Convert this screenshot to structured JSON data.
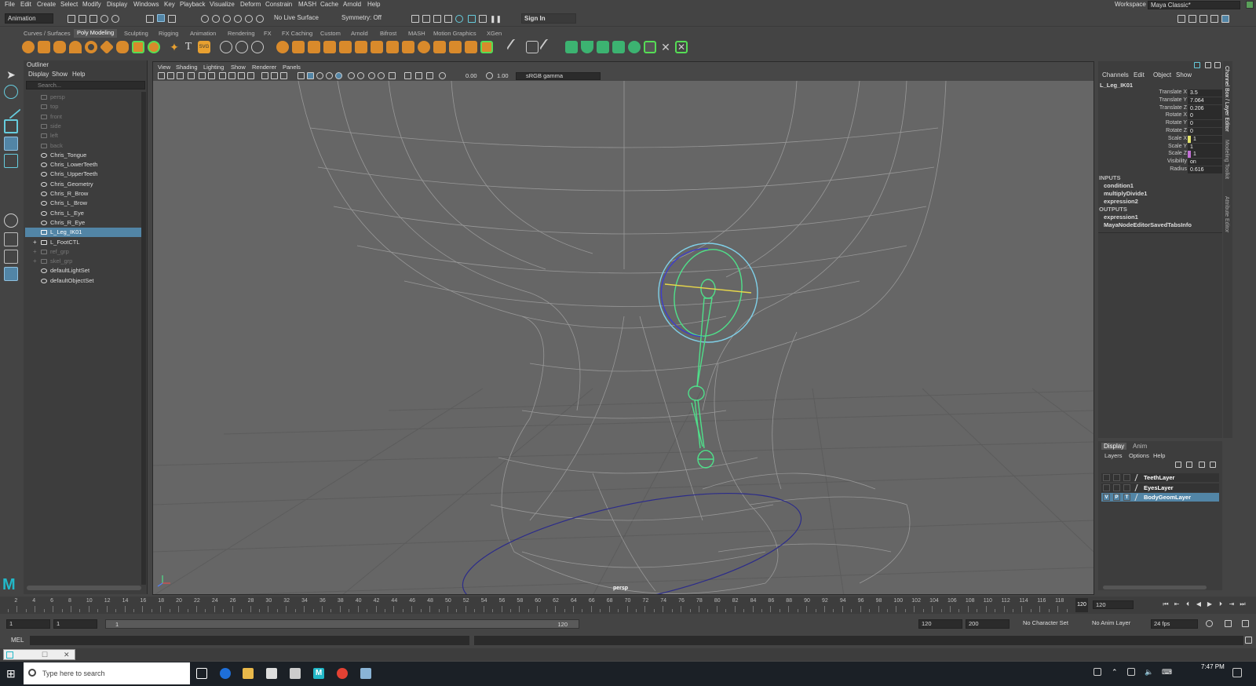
{
  "menubar": {
    "items": [
      "File",
      "Edit",
      "Create",
      "Select",
      "Modify",
      "Display",
      "Windows",
      "Key",
      "Playback",
      "Visualize",
      "Deform",
      "Constrain",
      "MASH",
      "Cache",
      "Arnold",
      "Help"
    ],
    "workspace_label": "Workspace :",
    "workspace_value": "Maya Classic*"
  },
  "statusline": {
    "mode": "Animation",
    "live_surface": "No Live Surface",
    "symmetry": "Symmetry: Off",
    "sign_in": "Sign In"
  },
  "shelf": {
    "tabs": [
      "Curves / Surfaces",
      "Poly Modeling",
      "Sculpting",
      "Rigging",
      "Animation",
      "Rendering",
      "FX",
      "FX Caching",
      "Custom",
      "Arnold",
      "Bifrost",
      "MASH",
      "Motion Graphics",
      "XGen"
    ],
    "active_tab": "Poly Modeling"
  },
  "outliner": {
    "title": "Outliner",
    "menu": [
      "Display",
      "Show",
      "Help"
    ],
    "search_placeholder": "Search...",
    "items": [
      {
        "label": "persp",
        "type": "camera",
        "dim": true,
        "selected": false,
        "expand": false
      },
      {
        "label": "top",
        "type": "camera",
        "dim": true,
        "selected": false,
        "expand": false
      },
      {
        "label": "front",
        "type": "camera",
        "dim": true,
        "selected": false,
        "expand": false
      },
      {
        "label": "side",
        "type": "camera",
        "dim": true,
        "selected": false,
        "expand": false
      },
      {
        "label": "left",
        "type": "camera",
        "dim": true,
        "selected": false,
        "expand": false
      },
      {
        "label": "back",
        "type": "camera",
        "dim": true,
        "selected": false,
        "expand": false
      },
      {
        "label": "Chris_Tongue",
        "type": "mesh",
        "dim": false,
        "selected": false,
        "expand": false
      },
      {
        "label": "Chris_LowerTeeth",
        "type": "mesh",
        "dim": false,
        "selected": false,
        "expand": false
      },
      {
        "label": "Chris_UpperTeeth",
        "type": "mesh",
        "dim": false,
        "selected": false,
        "expand": false
      },
      {
        "label": "Chris_Geometry",
        "type": "mesh",
        "dim": false,
        "selected": false,
        "expand": false
      },
      {
        "label": "Chris_R_Brow",
        "type": "mesh",
        "dim": false,
        "selected": false,
        "expand": false
      },
      {
        "label": "Chris_L_Brow",
        "type": "mesh",
        "dim": false,
        "selected": false,
        "expand": false
      },
      {
        "label": "Chris_L_Eye",
        "type": "mesh",
        "dim": false,
        "selected": false,
        "expand": false
      },
      {
        "label": "Chris_R_Eye",
        "type": "mesh",
        "dim": false,
        "selected": false,
        "expand": false
      },
      {
        "label": "L_Leg_IK01",
        "type": "ik",
        "dim": false,
        "selected": true,
        "expand": false
      },
      {
        "label": "L_FootCTL",
        "type": "curve",
        "dim": false,
        "selected": false,
        "expand": true
      },
      {
        "label": "ref_grp",
        "type": "group",
        "dim": true,
        "selected": false,
        "expand": true
      },
      {
        "label": "skel_grp",
        "type": "group",
        "dim": true,
        "selected": false,
        "expand": true
      },
      {
        "label": "defaultLightSet",
        "type": "set",
        "dim": false,
        "selected": false,
        "expand": false
      },
      {
        "label": "defaultObjectSet",
        "type": "set",
        "dim": false,
        "selected": false,
        "expand": false
      }
    ]
  },
  "viewport": {
    "menu": [
      "View",
      "Shading",
      "Lighting",
      "Show",
      "Renderer",
      "Panels"
    ],
    "exposure": "0.00",
    "gamma_value": "1.00",
    "color_space": "sRGB gamma",
    "camera_label": "persp"
  },
  "channelbox": {
    "menu": [
      "Channels",
      "Edit",
      "Object",
      "Show"
    ],
    "object_name": "L_Leg_IK01",
    "attributes": [
      {
        "name": "Translate X",
        "value": "3.5",
        "key": ""
      },
      {
        "name": "Translate Y",
        "value": "7.064",
        "key": ""
      },
      {
        "name": "Translate Z",
        "value": "0.206",
        "key": ""
      },
      {
        "name": "Rotate X",
        "value": "0",
        "key": ""
      },
      {
        "name": "Rotate Y",
        "value": "0",
        "key": ""
      },
      {
        "name": "Rotate Z",
        "value": "0",
        "key": ""
      },
      {
        "name": "Scale X",
        "value": "1",
        "key": "yellow"
      },
      {
        "name": "Scale Y",
        "value": "1",
        "key": ""
      },
      {
        "name": "Scale Z",
        "value": "1",
        "key": "purple"
      },
      {
        "name": "Visibility",
        "value": "on",
        "key": ""
      },
      {
        "name": "Radius",
        "value": "0.616",
        "key": ""
      }
    ],
    "inputs_header": "INPUTS",
    "inputs": [
      "condition1",
      "multiplyDivide1",
      "expression2"
    ],
    "outputs_header": "OUTPUTS",
    "outputs": [
      "expression1",
      "MayaNodeEditorSavedTabsInfo"
    ]
  },
  "sidetabs": [
    "Channel Box / Layer Editor",
    "Modeling Toolkit",
    "Attribute Editor"
  ],
  "layers": {
    "tabs": [
      "Display",
      "Anim"
    ],
    "menu": [
      "Layers",
      "Options",
      "Help"
    ],
    "rows": [
      {
        "name": "TeethLayer",
        "v": "",
        "p": "",
        "t": "",
        "selected": false
      },
      {
        "name": "EyesLayer",
        "v": "",
        "p": "",
        "t": "",
        "selected": false
      },
      {
        "name": "BodyGeomLayer",
        "v": "V",
        "p": "P",
        "t": "T",
        "selected": true
      }
    ]
  },
  "timeline": {
    "ticks": [
      "2",
      "4",
      "6",
      "8",
      "10",
      "12",
      "14",
      "16",
      "18",
      "20",
      "22",
      "24",
      "26",
      "28",
      "30",
      "32",
      "34",
      "36",
      "38",
      "40",
      "42",
      "44",
      "46",
      "48",
      "50",
      "52",
      "54",
      "56",
      "58",
      "60",
      "62",
      "64",
      "66",
      "68",
      "70",
      "72",
      "74",
      "76",
      "78",
      "80",
      "82",
      "84",
      "86",
      "88",
      "90",
      "92",
      "94",
      "96",
      "98",
      "100",
      "102",
      "104",
      "106",
      "108",
      "110",
      "112",
      "114",
      "116",
      "118"
    ],
    "current_frame": "120",
    "current_field": "120"
  },
  "range": {
    "start": "1",
    "playback_start": "1",
    "range_start_label": "1",
    "range_end_label": "120",
    "playback_end": "120",
    "end": "200",
    "character_set": "No Character Set",
    "anim_layer": "No Anim Layer",
    "fps": "24 fps"
  },
  "cmdline": {
    "lang": "MEL"
  },
  "taskbar": {
    "search_placeholder": "Type here to search",
    "time": "7:47 PM"
  },
  "colors": {
    "selection": "#5285a6",
    "rig_green": "#4fe08a",
    "rig_cyan": "#7fd0e8",
    "maya_logo": "#22b8c8"
  }
}
